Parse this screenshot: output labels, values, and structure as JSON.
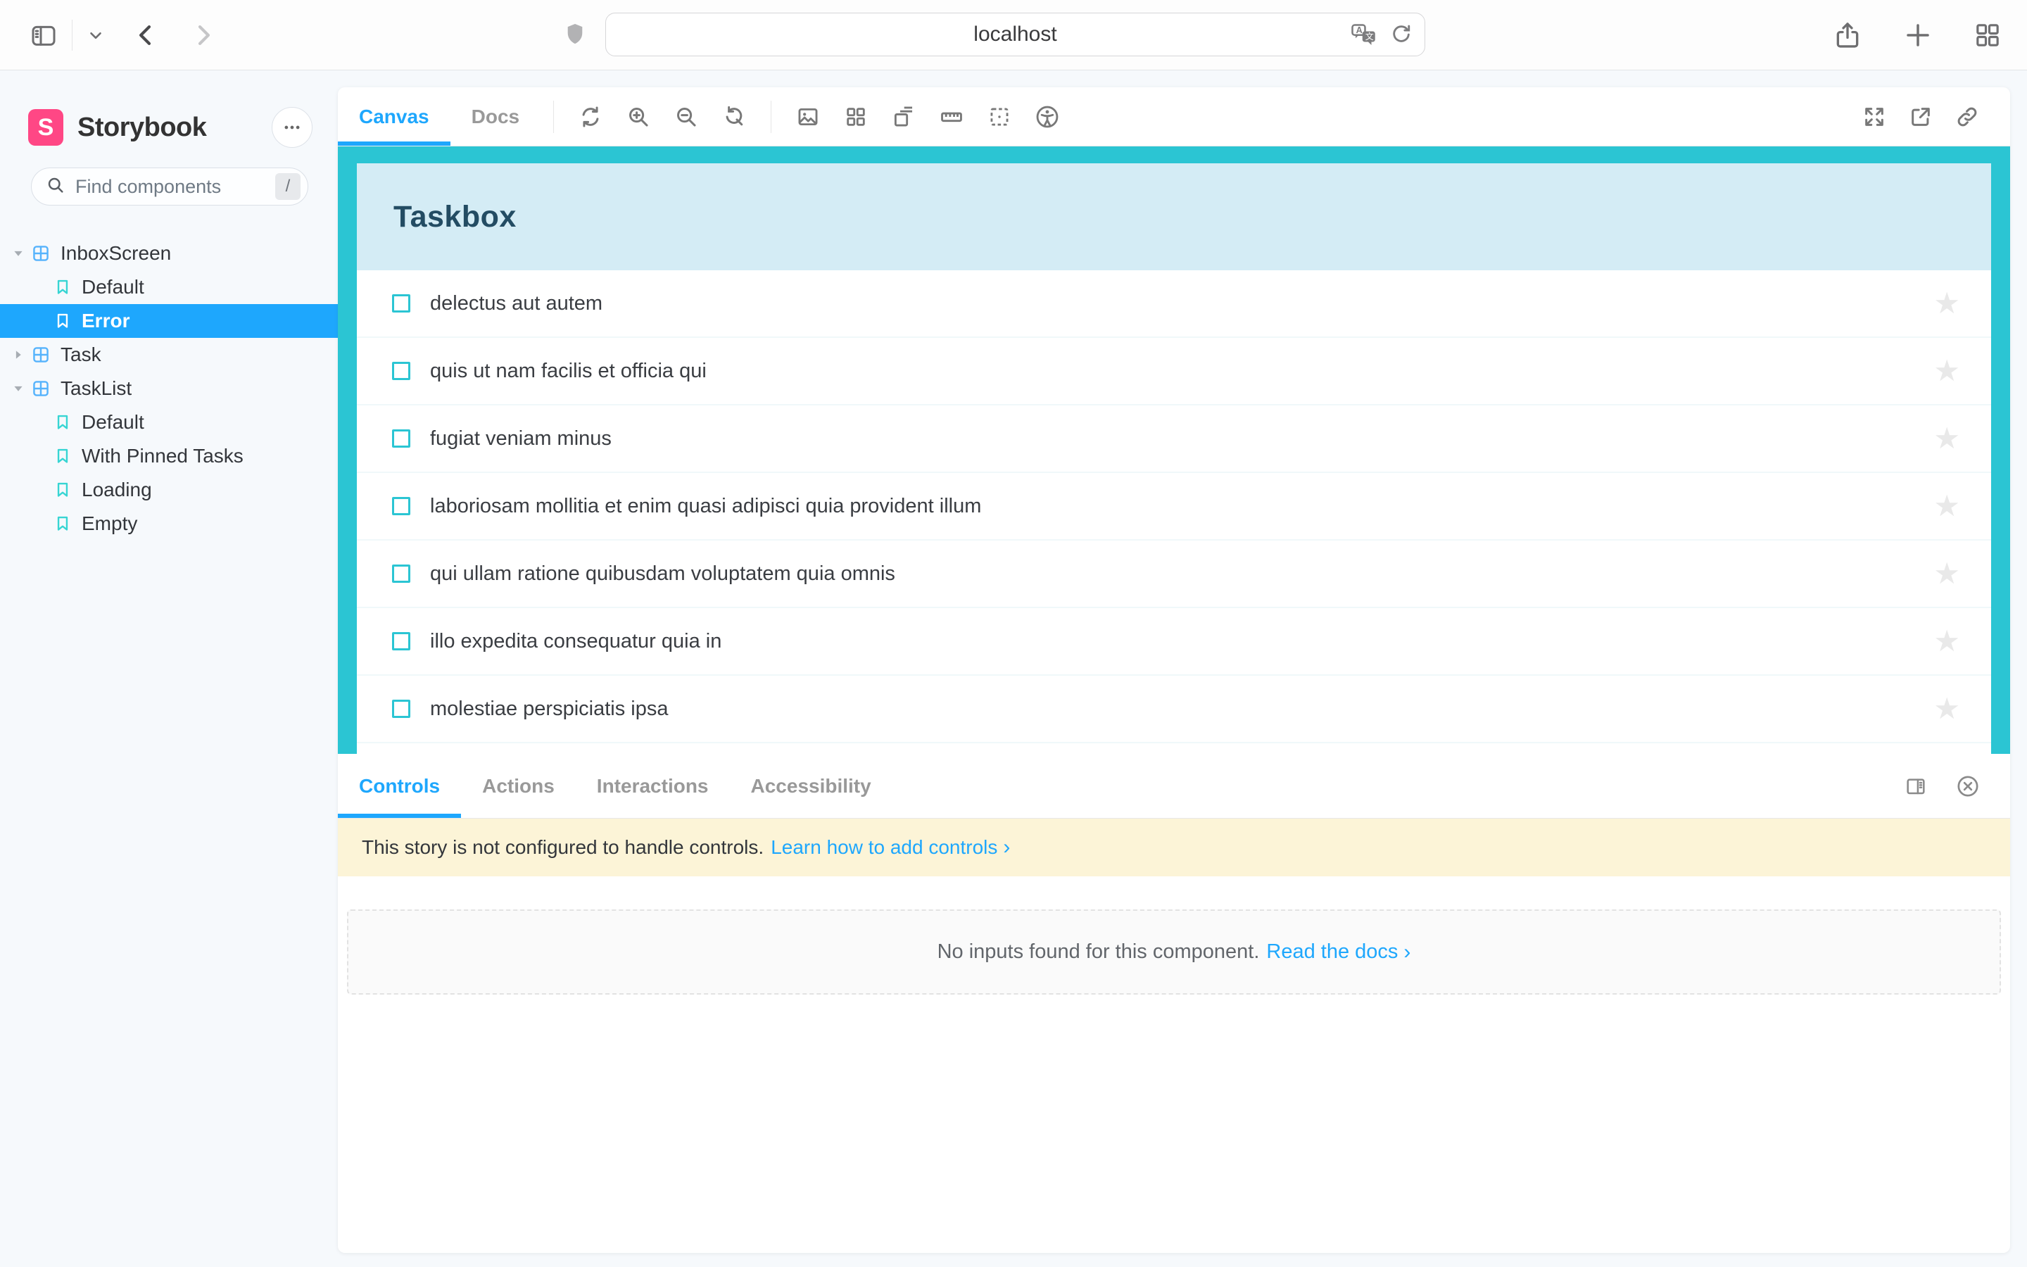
{
  "browser": {
    "url": "localhost"
  },
  "sidebar": {
    "brand": "Storybook",
    "logo_letter": "S",
    "search_placeholder": "Find components",
    "search_shortcut": "/",
    "tree": [
      {
        "type": "component",
        "label": "InboxScreen",
        "expanded": true
      },
      {
        "type": "story",
        "label": "Default",
        "selected": false
      },
      {
        "type": "story",
        "label": "Error",
        "selected": true
      },
      {
        "type": "component",
        "label": "Task",
        "expanded": false
      },
      {
        "type": "component",
        "label": "TaskList",
        "expanded": true
      },
      {
        "type": "story",
        "label": "Default",
        "selected": false
      },
      {
        "type": "story",
        "label": "With Pinned Tasks",
        "selected": false
      },
      {
        "type": "story",
        "label": "Loading",
        "selected": false
      },
      {
        "type": "story",
        "label": "Empty",
        "selected": false
      }
    ]
  },
  "toolbar": {
    "tabs": [
      {
        "label": "Canvas",
        "active": true
      },
      {
        "label": "Docs",
        "active": false
      }
    ]
  },
  "preview": {
    "app_title": "Taskbox",
    "tasks": [
      "delectus aut autem",
      "quis ut nam facilis et officia qui",
      "fugiat veniam minus",
      "laboriosam mollitia et enim quasi adipisci quia provident illum",
      "qui ullam ratione quibusdam voluptatem quia omnis",
      "illo expedita consequatur quia in",
      "molestiae perspiciatis ipsa"
    ],
    "star_glyph": "★"
  },
  "panel": {
    "tabs": [
      "Controls",
      "Actions",
      "Interactions",
      "Accessibility"
    ],
    "active_tab": "Controls",
    "warning": {
      "text": "This story is not configured to handle controls.",
      "link": "Learn how to add controls",
      "chevron": "›"
    },
    "empty": {
      "text": "No inputs found for this component.",
      "link": "Read the docs",
      "chevron": "›"
    }
  },
  "colors": {
    "accent_blue": "#1EA7FD",
    "brand_pink": "#FF4785",
    "preview_teal": "#2BC5D3",
    "story_icon_teal": "#37D5D3",
    "warning_bg": "#FCF4D7",
    "header_light_blue": "#D4ECF5"
  }
}
